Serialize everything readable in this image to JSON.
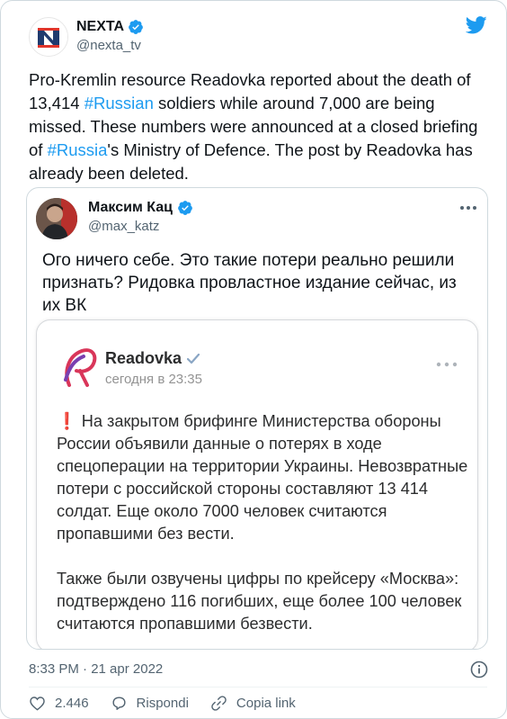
{
  "tweet": {
    "author_name": "NEXTA",
    "handle": "@nexta_tv",
    "text_parts": {
      "p1": "Pro-Kremlin resource Readovka reported about the death of 13,414 ",
      "tag1": "#Russian",
      "p2": " soldiers while around 7,000 are being missed. These numbers were announced at a closed briefing of ",
      "tag2": "#Russia",
      "p3": "'s Ministry of Defence. The post by Readovka has already been deleted."
    },
    "timestamp": "8:33 PM · 21 apr 2022"
  },
  "quoted": {
    "author_name": "Максим Кац",
    "handle": "@max_katz",
    "text": "Ого ничего себе. Это такие потери реально решили признать? Ридовка провластное издание сейчас, из их ВК"
  },
  "embedded_post": {
    "source_name": "Readovka",
    "time": "сегодня в 23:35",
    "exclaim": "❗",
    "para1": " На закрытом брифинге Министерства обороны России объявили данные о потерях в ходе спецоперации на территории Украины. Невозвратные потери с российской стороны составляют 13 414 солдат. Еще около 7000 человек считаются пропавшими без вести.",
    "para2": "Также были озвучены цифры по крейсеру «Москва»: подтверждено 116 погибших, еще более 100 человек считаются пропавшими безвести."
  },
  "actions": {
    "likes_count": "2.446",
    "reply_label": "Rispondi",
    "copy_link_label": "Copia link"
  },
  "colors": {
    "brand_blue": "#1d9bf0",
    "nexta_red": "#e0352b",
    "text": "#0f1419",
    "muted": "#536471"
  },
  "icons": [
    "nexta-logo",
    "verified-badge-icon",
    "twitter-bird-icon",
    "more-icon",
    "readovka-logo",
    "check-icon",
    "info-icon",
    "heart-icon",
    "reply-icon",
    "link-icon"
  ]
}
